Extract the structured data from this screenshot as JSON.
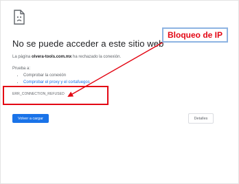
{
  "error_page": {
    "icon": "sad-document-icon",
    "title": "No se puede acceder a este sitio web",
    "description_prefix": "La página ",
    "domain": "olvera-tools.com.mx",
    "description_suffix": " ha rechazado la conexión.",
    "try_label": "Prueba a:",
    "suggestions": [
      "Comprobar la conexión",
      "Comprobar el proxy y el cortafuegos"
    ],
    "error_code": "ERR_CONNECTION_REFUSED",
    "reload_label": "Volver a cargar",
    "details_label": "Detalles"
  },
  "annotation": {
    "label": "Bloqueo de IP",
    "color": "#e30613",
    "badge_border_color": "#8db3e2"
  },
  "colors": {
    "link": "#1a73e8",
    "primary_button": "#1a73e8",
    "text_secondary": "#5f6368"
  }
}
